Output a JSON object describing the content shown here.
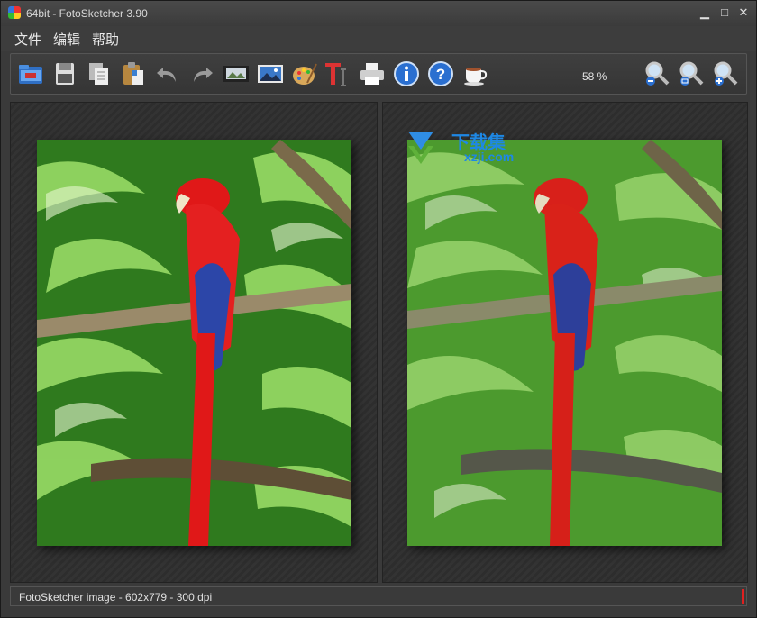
{
  "window": {
    "title": "64bit - FotoSketcher 3.90",
    "minimize_glyph": "▁",
    "maximize_glyph": "□",
    "close_glyph": "✕"
  },
  "menu": {
    "items": [
      {
        "label": "文件"
      },
      {
        "label": "编辑"
      },
      {
        "label": "帮助"
      }
    ]
  },
  "toolbar": {
    "tools": [
      {
        "icon": "open-folder-icon"
      },
      {
        "icon": "save-icon"
      },
      {
        "icon": "copy-icon"
      },
      {
        "icon": "paste-icon"
      },
      {
        "icon": "undo-icon"
      },
      {
        "icon": "redo-icon"
      },
      {
        "icon": "filmstrip-icon"
      },
      {
        "icon": "picture-icon"
      },
      {
        "icon": "palette-icon"
      },
      {
        "icon": "text-tool-icon"
      },
      {
        "icon": "printer-icon"
      },
      {
        "icon": "info-icon"
      },
      {
        "icon": "help-icon"
      },
      {
        "icon": "coffee-cup-icon"
      }
    ],
    "zoom_level": "58 %",
    "zoom_tools": [
      {
        "icon": "zoom-out-icon"
      },
      {
        "icon": "zoom-fit-icon"
      },
      {
        "icon": "zoom-in-icon"
      }
    ]
  },
  "watermark": {
    "line1": "下载集",
    "line2": "xzji.com"
  },
  "status": {
    "text": "FotoSketcher image - 602x779 - 300 dpi"
  },
  "colors": {
    "accent_red": "#e02020",
    "watermark_blue": "#1e88e5"
  }
}
